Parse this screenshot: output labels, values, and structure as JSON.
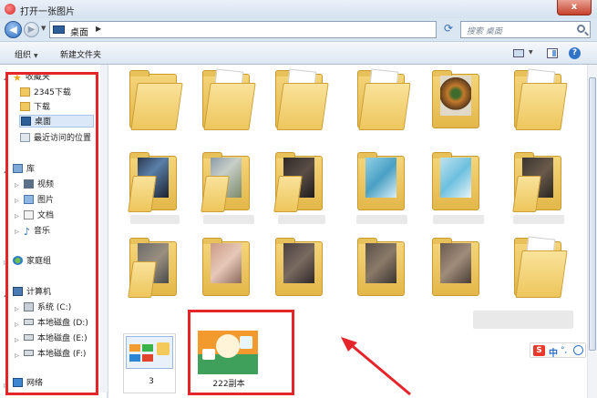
{
  "window": {
    "title": "打开一张图片",
    "close_glyph": "x"
  },
  "address": {
    "location": "桌面",
    "search_placeholder": "搜索 桌面"
  },
  "toolbar": {
    "organize": "组织",
    "new_folder": "新建文件夹"
  },
  "nav": {
    "favorites": "收藏夹",
    "fav_items": [
      "2345下载",
      "下载",
      "桌面",
      "最近访问的位置"
    ],
    "library": "库",
    "lib_items": [
      "视频",
      "图片",
      "文档",
      "音乐"
    ],
    "homegroup": "家庭组",
    "computer": "计算机",
    "drives": [
      "系统 (C:)",
      "本地磁盘 (D:)",
      "本地磁盘 (E:)",
      "本地磁盘 (F:)"
    ],
    "network": "网络"
  },
  "files": [
    {
      "label": "3"
    },
    {
      "label": "222副本"
    }
  ],
  "ime": {
    "logo": "S",
    "lang": "中"
  },
  "colors": {
    "highlight": "#e6252b",
    "selected_bg": "#dbe8f7",
    "folder": "#f0c860"
  }
}
